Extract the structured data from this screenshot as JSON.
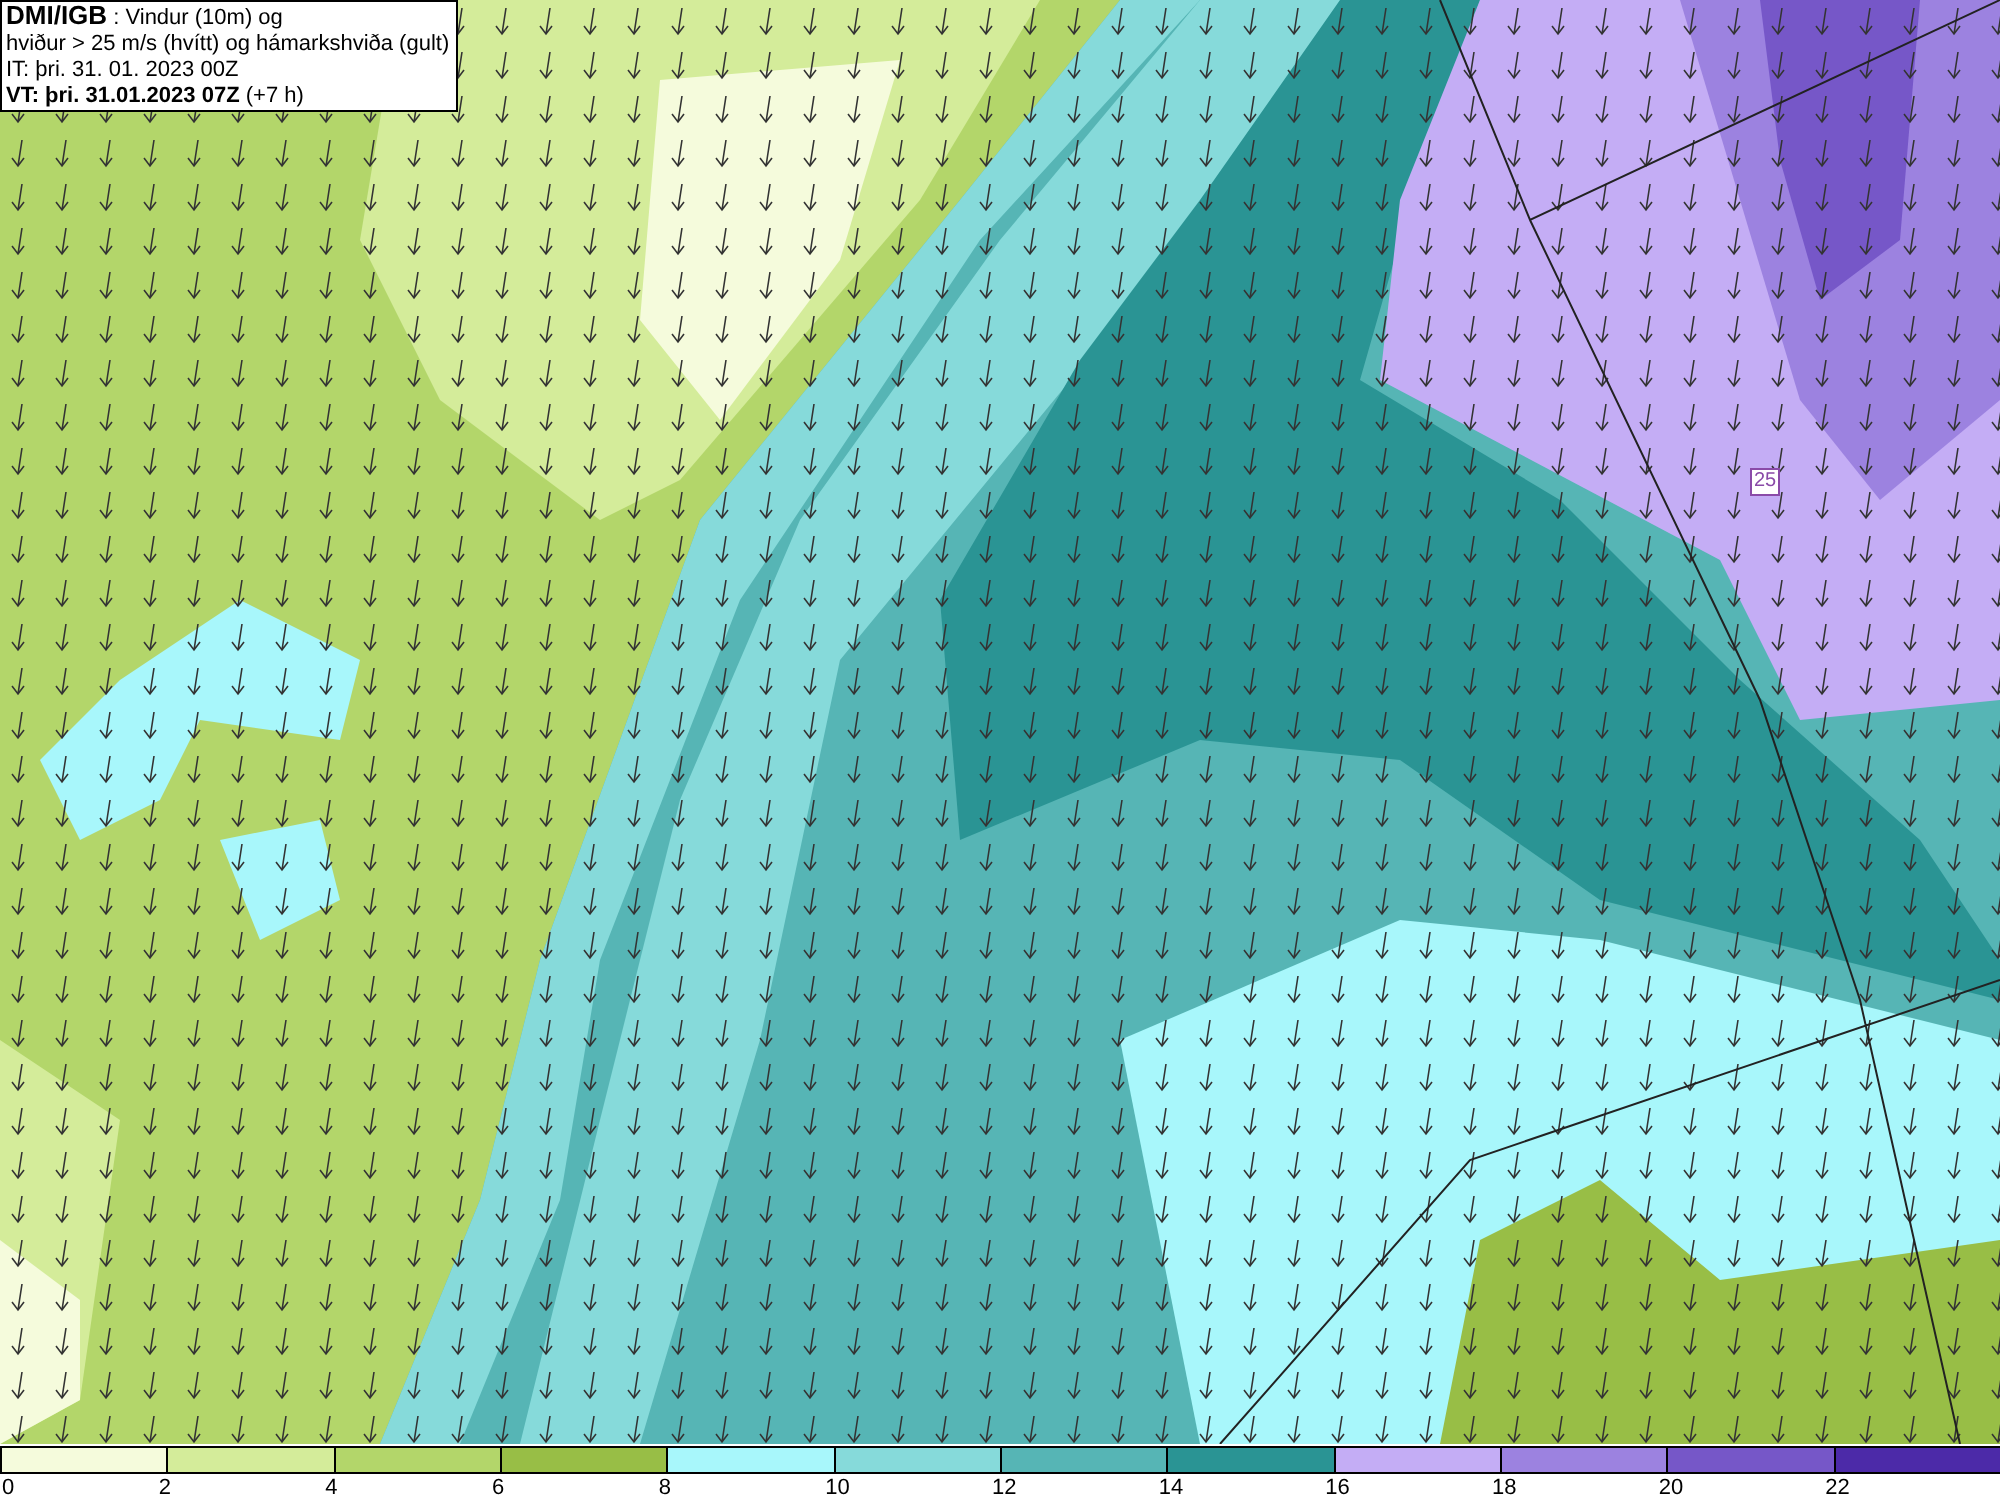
{
  "info_box": {
    "title": "DMI/IGB",
    "title_suffix": " : Vindur (10m) og",
    "line_2": "hviður > 25 m/s (hvítt) og hámarkshviða (gult)",
    "issue_time": "IT: þri. 31. 01. 2023 00Z",
    "valid_time": "VT: þri. 31.01.2023 07Z",
    "valid_offset": " (+7 h)"
  },
  "contour_label": "25",
  "legend": [
    {
      "label": "0",
      "color": "#f5fbdc"
    },
    {
      "label": "2",
      "color": "#d4ec9a"
    },
    {
      "label": "4",
      "color": "#b3d66a"
    },
    {
      "label": "6",
      "color": "#98be46"
    },
    {
      "label": "8",
      "color": "#a8f7fb"
    },
    {
      "label": "10",
      "color": "#86dada"
    },
    {
      "label": "12",
      "color": "#56b5b5"
    },
    {
      "label": "14",
      "color": "#2a9494"
    },
    {
      "label": "16",
      "color": "#c4adf5"
    },
    {
      "label": "18",
      "color": "#9c82e0"
    },
    {
      "label": "20",
      "color": "#7657c8"
    },
    {
      "label": "22",
      "color": "#4c2aa8"
    }
  ]
}
